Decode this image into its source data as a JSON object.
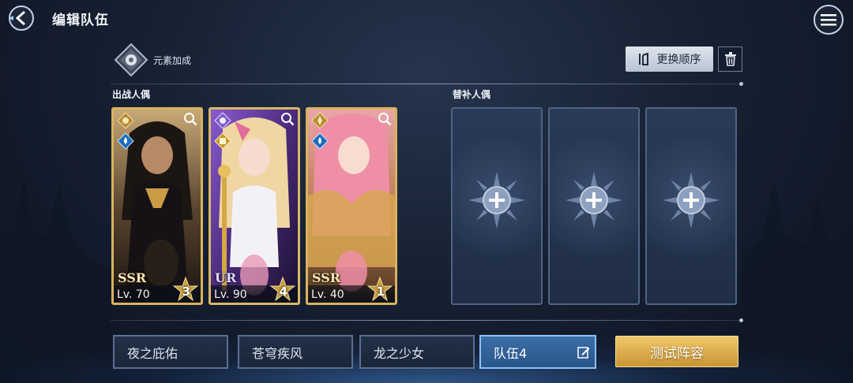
{
  "header": {
    "title": "编辑队伍"
  },
  "element_bonus": {
    "label": "元素加成"
  },
  "actions": {
    "order_label": "更换顺序"
  },
  "sections": {
    "active_label": "出战人偶",
    "substitute_label": "替补人偶"
  },
  "active_cards": [
    {
      "rarity": "SSR",
      "level": "Lv. 70",
      "stars": "3",
      "element": "water"
    },
    {
      "rarity": "UR",
      "level": "Lv. 90",
      "stars": "4",
      "element": "light"
    },
    {
      "rarity": "SSR",
      "level": "Lv. 40",
      "stars": "1",
      "element": "water"
    }
  ],
  "substitute_slots": [
    "empty",
    "empty",
    "empty"
  ],
  "teams": [
    {
      "label": "夜之庇佑",
      "active": false
    },
    {
      "label": "苍穹疾风",
      "active": false
    },
    {
      "label": "龙之少女",
      "active": false
    },
    {
      "label": "队伍4",
      "active": true
    }
  ],
  "test_button": {
    "label": "测试阵容"
  },
  "colors": {
    "accent_gold": "#d8b35e",
    "active_tab": "#3c6ea8",
    "test_button": "#e3b252"
  }
}
